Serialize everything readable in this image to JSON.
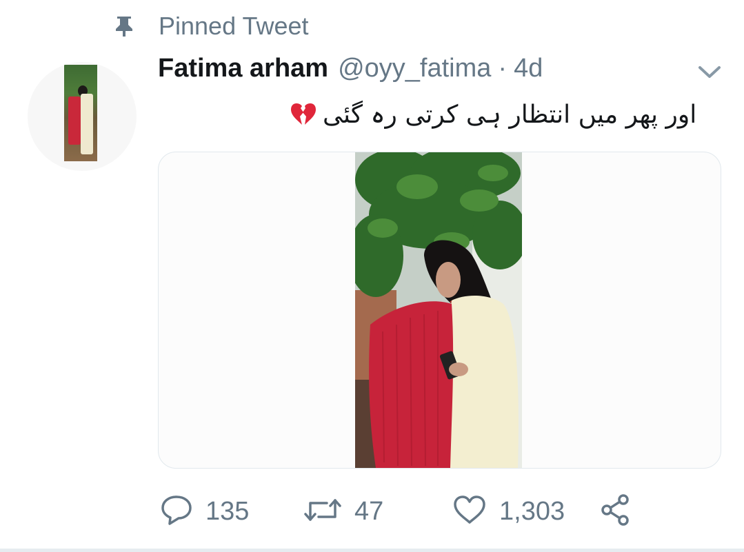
{
  "pinned": {
    "label": "Pinned Tweet",
    "icon": "pin-icon"
  },
  "author": {
    "name": "Fatima arham",
    "handle": "@oyy_fatima",
    "separator": "·",
    "age": "4d"
  },
  "tweet": {
    "text": "اور پھر میں انتظار ہی کرتی رہ گئی",
    "emoji_icon": "broken-heart-icon"
  },
  "media": {
    "icon": "photo"
  },
  "actions": {
    "reply": {
      "icon": "reply-icon",
      "count": "135"
    },
    "retweet": {
      "icon": "retweet-icon",
      "count": "47"
    },
    "like": {
      "icon": "heart-icon",
      "count": "1,303"
    },
    "share": {
      "icon": "share-icon"
    }
  },
  "colors": {
    "secondary_text": "#657786",
    "primary_text": "#14171a",
    "border": "#e1e8ed",
    "broken_heart": "#e0263a"
  }
}
